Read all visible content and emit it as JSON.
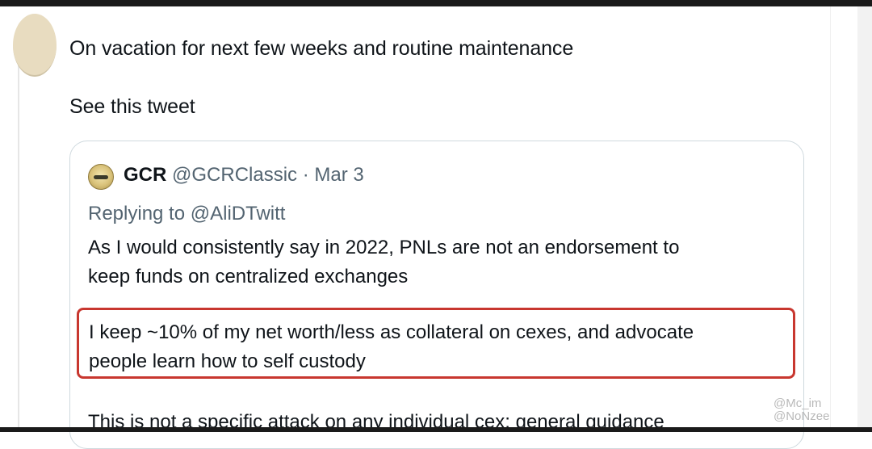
{
  "tweet": {
    "line1": "On vacation for next few weeks and routine maintenance",
    "line2": "See this tweet"
  },
  "quote": {
    "name": "GCR",
    "handle": "@GCRClassic",
    "separator": "·",
    "date": "Mar 3",
    "replying_to": "Replying to @AliDTwitt",
    "paragraph1_line1": "As I would consistently say in 2022, PNLs are not an endorsement to",
    "paragraph1_line2": "keep funds on centralized exchanges",
    "paragraph2_line1": "I keep ~10% of my net worth/less as collateral on cexes, and advocate",
    "paragraph2_line2": "people learn how to self custody",
    "paragraph3": "This is not a specific attack on any individual cex; general guidance"
  },
  "watermark": {
    "line1": "@Mc_im",
    "line2": "@NoNzee"
  },
  "colors": {
    "highlight_border": "#c8372f",
    "secondary_text": "#536471",
    "card_border": "#cfd9de"
  }
}
